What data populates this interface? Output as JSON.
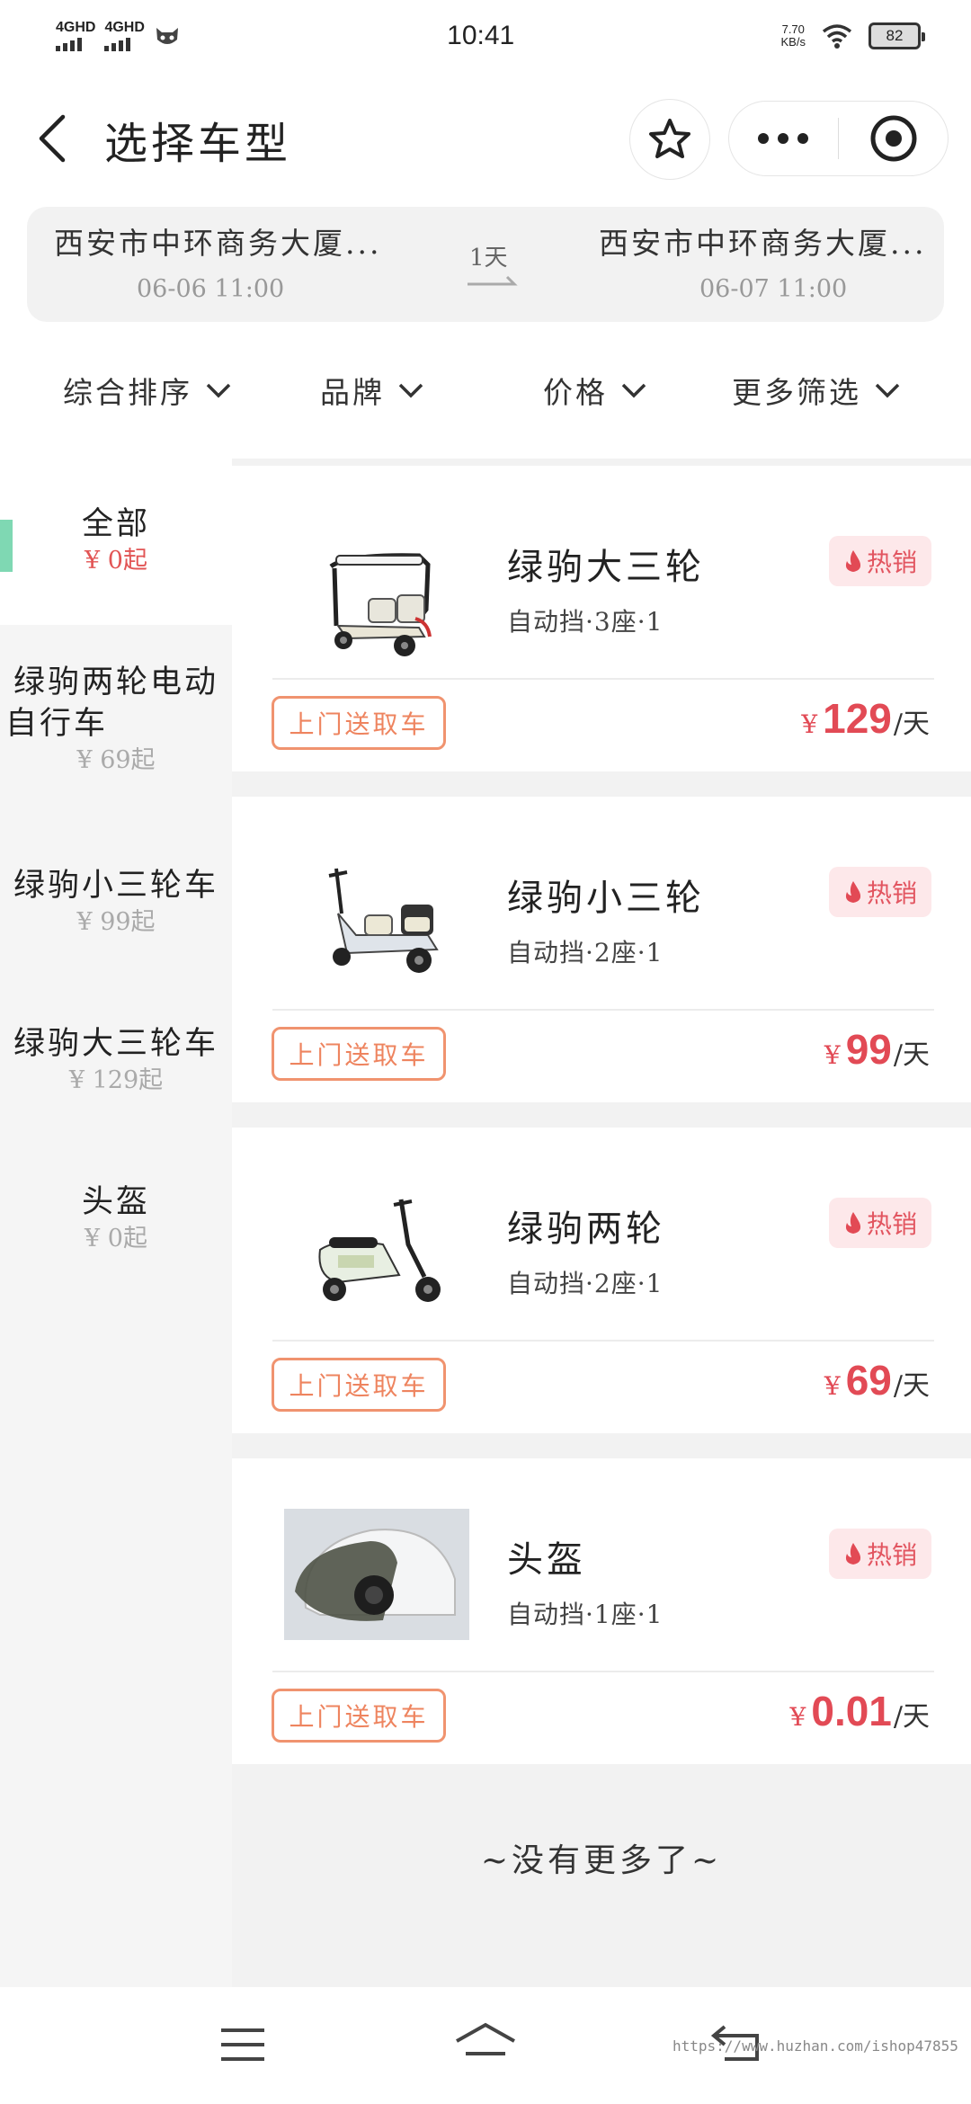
{
  "status_bar": {
    "network1": "4GHD",
    "network2": "4GHD",
    "time": "10:41",
    "speed_value": "7.70",
    "speed_unit": "KB/s",
    "battery": "82"
  },
  "header": {
    "title": "选择车型"
  },
  "route": {
    "from_location": "西安市中环商务大厦...",
    "from_datetime": "06-06 11:00",
    "duration": "1天",
    "to_location": "西安市中环商务大厦...",
    "to_datetime": "06-07 11:00"
  },
  "filters": [
    {
      "label": "综合排序"
    },
    {
      "label": "品牌"
    },
    {
      "label": "价格"
    },
    {
      "label": "更多筛选"
    }
  ],
  "sidebar": {
    "items": [
      {
        "name": "全部",
        "price": "¥ 0起",
        "active": true
      },
      {
        "name_line1": "绿驹两轮电动",
        "name_line2": "自行车",
        "price": "¥ 69起"
      },
      {
        "name": "绿驹小三轮车",
        "price": "¥ 99起"
      },
      {
        "name": "绿驹大三轮车",
        "price": "¥ 129起"
      },
      {
        "name": "头盔",
        "price": "¥ 0起"
      }
    ]
  },
  "vehicles": [
    {
      "name": "绿驹大三轮",
      "spec": "自动挡·3座·1",
      "badge": "热销",
      "delivery": "上门送取车",
      "currency": "¥",
      "price": "129",
      "unit": "/天",
      "image": "large-tricycle"
    },
    {
      "name": "绿驹小三轮",
      "spec": "自动挡·2座·1",
      "badge": "热销",
      "delivery": "上门送取车",
      "currency": "¥",
      "price": "99",
      "unit": "/天",
      "image": "small-tricycle"
    },
    {
      "name": "绿驹两轮",
      "spec": "自动挡·2座·1",
      "badge": "热销",
      "delivery": "上门送取车",
      "currency": "¥",
      "price": "69",
      "unit": "/天",
      "image": "scooter"
    },
    {
      "name": "头盔",
      "spec": "自动挡·1座·1",
      "badge": "热销",
      "delivery": "上门送取车",
      "currency": "¥",
      "price": "0.01",
      "unit": "/天",
      "image": "helmet"
    }
  ],
  "footer_text": "~没有更多了~",
  "watermark": "https://www.huzhan.com/ishop47855",
  "colors": {
    "accent_red": "#e24a55",
    "delivery_orange": "#ee845f",
    "badge_bg": "#fde8ea",
    "active_mark": "#7fd8b3"
  }
}
